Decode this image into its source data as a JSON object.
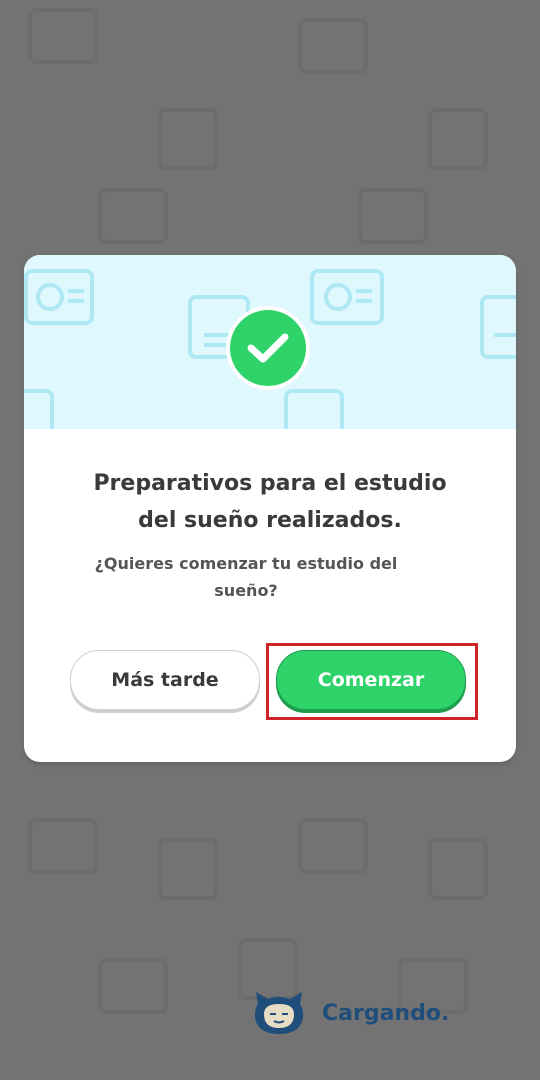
{
  "dialog": {
    "title_line1": "Preparativos para el estudio",
    "title_line2": "del sueño realizados.",
    "message_line1": "¿Quieres comenzar tu estudio del",
    "message_line2": "sueño?",
    "later_label": "Más tarde",
    "start_label": "Comenzar",
    "header_icon": "checkmark-icon"
  },
  "loading": {
    "text": "Cargando.",
    "icon": "snorlax-icon"
  },
  "colors": {
    "overlay": "#737373",
    "header_bg": "#dff8fd",
    "accent_green": "#2ed36a",
    "highlight_red": "#d1232a",
    "loading_text": "#1f4e7a"
  }
}
